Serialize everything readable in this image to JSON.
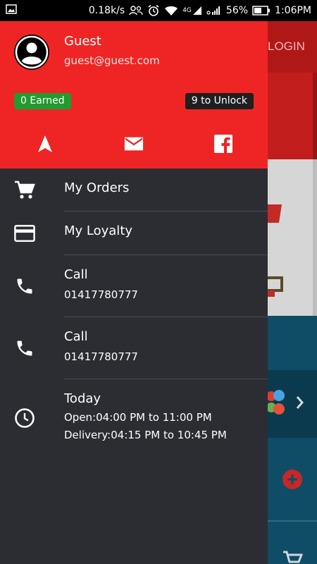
{
  "status_bar": {
    "speed": "0.18k/s",
    "network": "4G",
    "battery": "56%",
    "time": "1:06PM"
  },
  "background": {
    "login_label": "LOGIN"
  },
  "drawer": {
    "user": {
      "name": "Guest",
      "email": "guest@guest.com"
    },
    "earned_label": "0 Earned",
    "unlock_label": "9 to Unlock",
    "header_icons": [
      "navigation-icon",
      "mail-icon",
      "facebook-icon"
    ],
    "items": [
      {
        "label": "My Orders",
        "icon": "cart-icon"
      },
      {
        "label": "My Loyalty",
        "icon": "card-icon"
      },
      {
        "label": "Call",
        "sub": "01417780777",
        "icon": "phone-icon"
      },
      {
        "label": "Call",
        "sub": "01417780777",
        "icon": "phone-icon"
      },
      {
        "label": "Today",
        "sub": "Open:04:00 PM to 11:00 PM",
        "sub2": "Delivery:04:15 PM to 10:45 PM",
        "icon": "clock-icon"
      }
    ]
  },
  "colors": {
    "header_red": "#ee2524",
    "drawer_bg": "#2b2d33",
    "earned_green": "#219a30"
  }
}
